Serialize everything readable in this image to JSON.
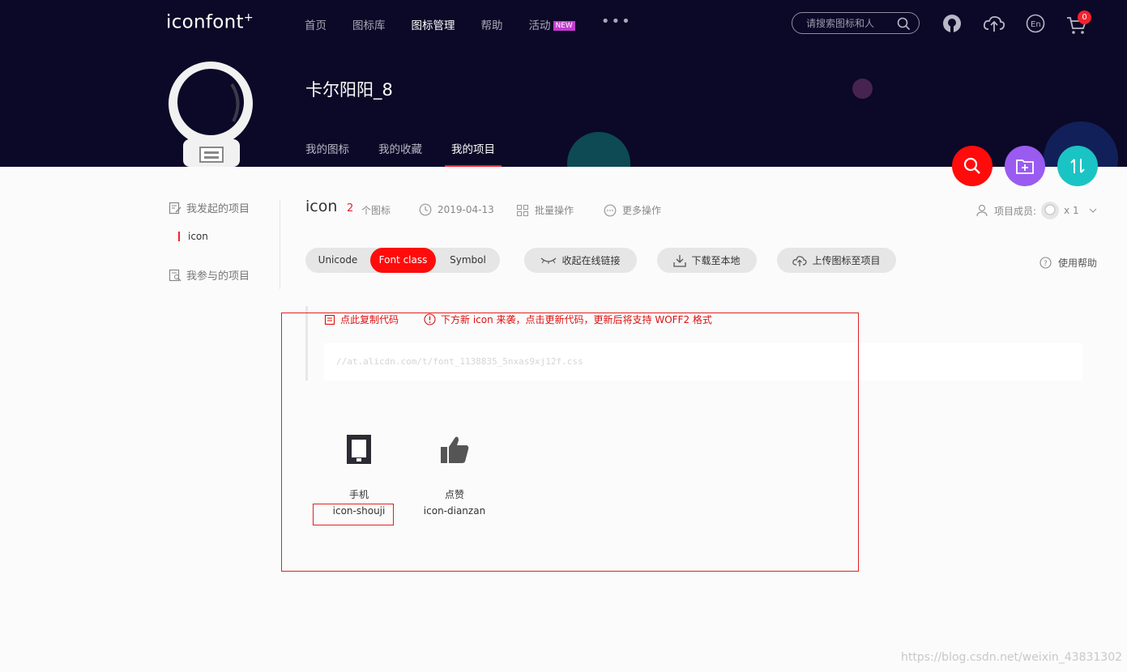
{
  "header": {
    "logo": "iconfont",
    "logo_mark": "+",
    "nav": [
      {
        "label": "首页"
      },
      {
        "label": "图标库"
      },
      {
        "label": "图标管理"
      },
      {
        "label": "帮助"
      },
      {
        "label": "活动",
        "badge": "NEW"
      }
    ],
    "more": "•••",
    "search_placeholder": "请搜索图标和人",
    "cart_count": "0"
  },
  "profile": {
    "username": "卡尔阳阳_8",
    "tabs": [
      {
        "label": "我的图标"
      },
      {
        "label": "我的收藏"
      },
      {
        "label": "我的项目",
        "active": true
      }
    ]
  },
  "sidebar": {
    "created_heading": "我发起的项目",
    "projects": [
      "icon"
    ],
    "joined_heading": "我参与的项目"
  },
  "project": {
    "title": "icon",
    "count": "2",
    "count_label": "个图标",
    "date": "2019-04-13",
    "batch": "批量操作",
    "more": "更多操作",
    "members_label": "项目成员:",
    "members_count": "x 1"
  },
  "toolbar": {
    "modes": [
      "Unicode",
      "Font class",
      "Symbol"
    ],
    "active_mode": "Font class",
    "collapse_link": "收起在线链接",
    "download": "下载至本地",
    "upload": "上传图标至项目",
    "help": "使用帮助"
  },
  "code": {
    "copy": "点此复制代码",
    "warning": "下方新 icon 来袭，点击更新代码，更新后将支持 WOFF2 格式",
    "url": "//at.alicdn.com/t/font_1138835_5nxas9xj12f.css"
  },
  "icons": [
    {
      "name": "手机",
      "class": "icon-shouji",
      "icon": "phone-icon"
    },
    {
      "name": "点赞",
      "class": "icon-dianzan",
      "icon": "thumbs-up-icon"
    }
  ],
  "watermark": "https://blog.csdn.net/weixin_43831302",
  "colors": {
    "header_bg": "#0b0927",
    "accent_red": "#ff0b0b",
    "fab_purple": "#9a5bf0",
    "fab_teal": "#1bc4c4"
  }
}
